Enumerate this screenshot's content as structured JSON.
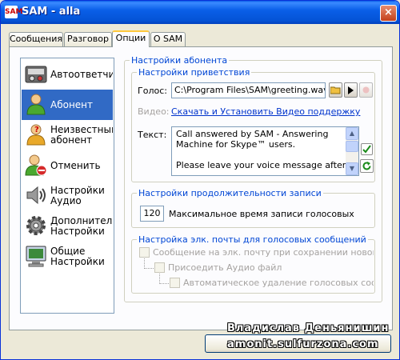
{
  "window": {
    "title": "SAM - alla",
    "app_icon": "SAM",
    "close_glyph": "×"
  },
  "tabs": [
    {
      "label": "Сообщения"
    },
    {
      "label": "Разговор"
    },
    {
      "label": "Опции",
      "active": true
    },
    {
      "label": "О SAM"
    }
  ],
  "sidebar": {
    "items": [
      {
        "label": "Автоответчик",
        "icon": "answering-machine-icon"
      },
      {
        "label": "Абонент",
        "icon": "user-icon",
        "selected": true
      },
      {
        "label": "Неизвестный\nабонент",
        "icon": "unknown-user-icon"
      },
      {
        "label": "Отменить",
        "icon": "user-cancel-icon"
      },
      {
        "label": "Настройки\nАудио",
        "icon": "speaker-icon"
      },
      {
        "label": "Дополнительные\nНастройки",
        "icon": "gear-icon"
      },
      {
        "label": "Общие\nНастройки",
        "icon": "computer-settings-icon"
      }
    ]
  },
  "subscriber": {
    "title": "Настройки абонента",
    "greeting": {
      "title": "Настройки приветствия",
      "voice_label": "Голос:",
      "voice_value": "C:\\Program Files\\SAM\\greeting.wav",
      "video_label": "Видео:",
      "video_link": "Скачать и Установить Видео поддержку",
      "text_label": "Текст:",
      "text_lines": [
        "Call answered by SAM - Answering",
        "Machine for Skype™ users.",
        "",
        "Please leave your voice message after"
      ]
    },
    "duration": {
      "title": "Настройки продолжительности записи",
      "value": "120",
      "label": "Максимальное время записи голосовых"
    },
    "email": {
      "title": "Настройка элк. почты для голосовых сообщений",
      "opt1": "Сообщение на элк. почту при сохранении нового голс",
      "opt2": "Присоедить Аудио файл",
      "opt3": "Автоматическое удаление голосовых сообщений"
    }
  },
  "watermark": {
    "line1": "Владислав Деньянишин",
    "line2": "amonit.sulfurzona.com"
  },
  "colors": {
    "titlebar": "#0a5fe8",
    "selection": "#316ac5",
    "group_title": "#0046d5",
    "link": "#0033cc"
  }
}
